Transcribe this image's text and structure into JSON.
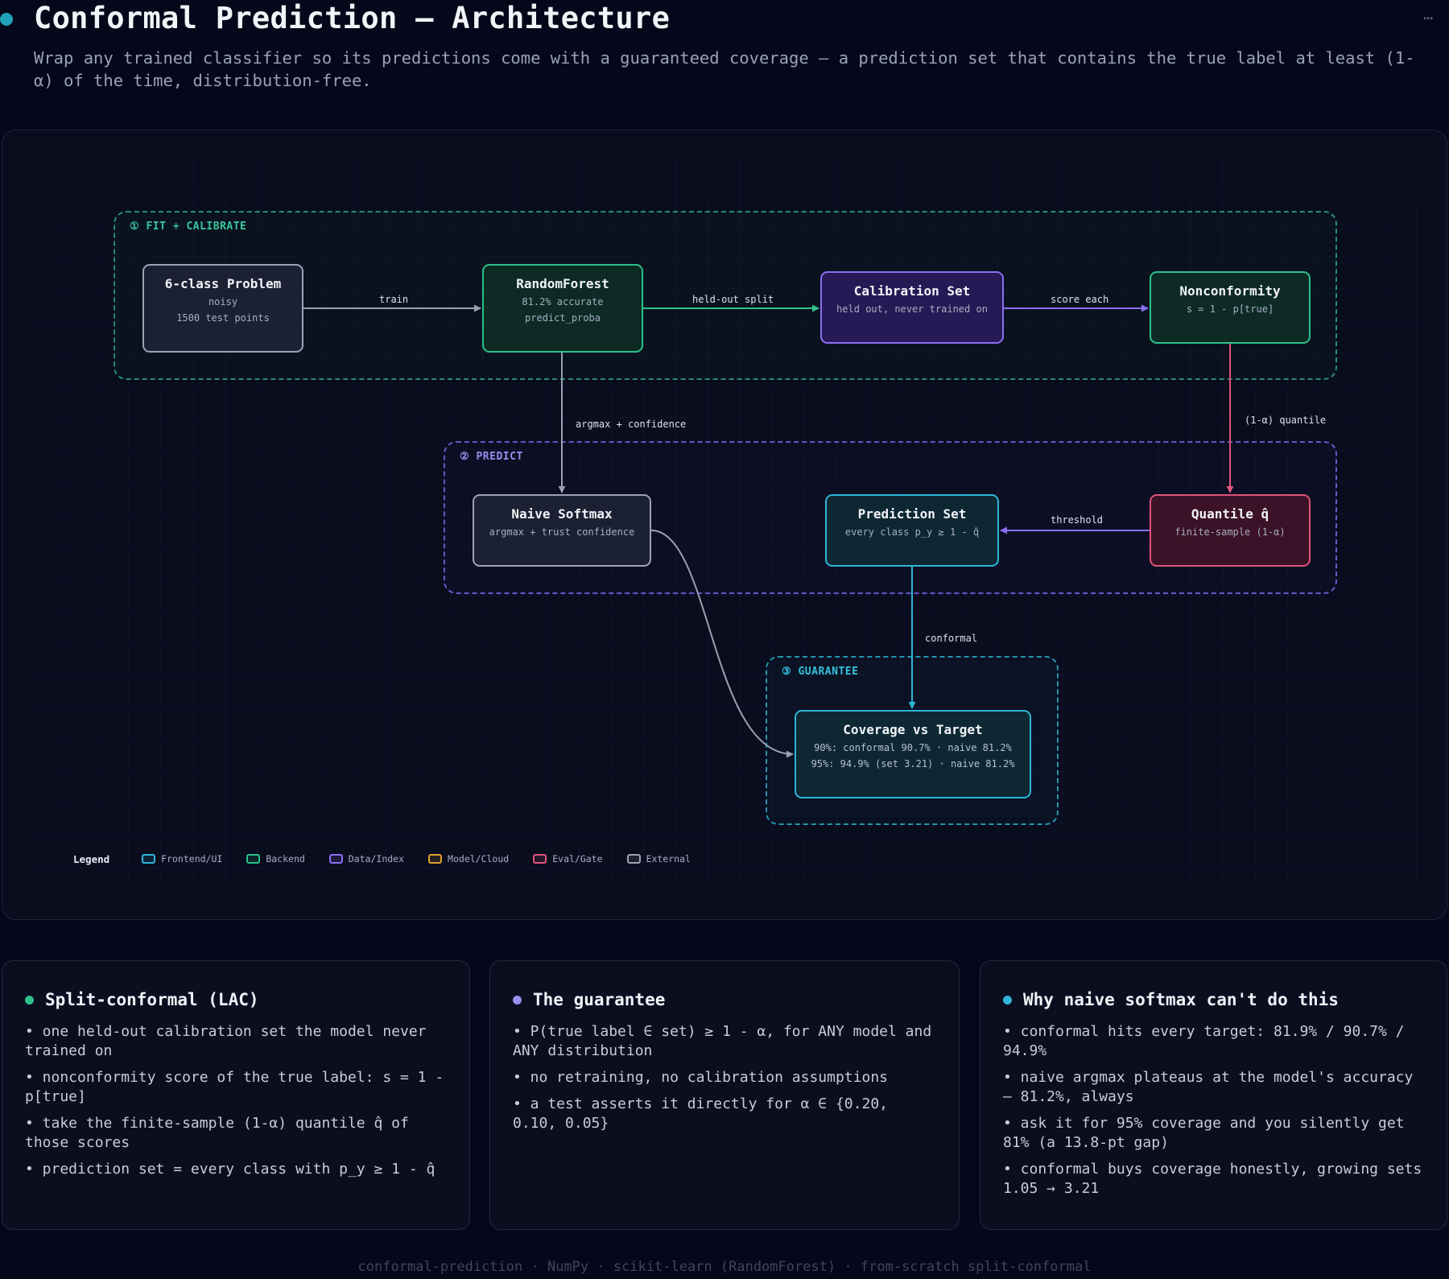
{
  "header": {
    "title": "Conformal Prediction — Architecture",
    "subtitle": "Wrap any trained classifier so its predictions come with a guaranteed coverage — a prediction set that contains the true label at least (1-α) of the time, distribution-free."
  },
  "groups": {
    "fit": "① FIT + CALIBRATE",
    "predict": "② PREDICT",
    "guarantee": "③ GUARANTEE"
  },
  "nodes": {
    "problem": {
      "title": "6-class Problem",
      "sub1": "noisy",
      "sub2": "1500 test points"
    },
    "rf": {
      "title": "RandomForest",
      "sub1": "81.2% accurate",
      "sub2": "predict_proba"
    },
    "calib": {
      "title": "Calibration Set",
      "sub1": "held out, never trained on"
    },
    "nonconf": {
      "title": "Nonconformity",
      "sub1": "s = 1 - p[true]"
    },
    "naive": {
      "title": "Naive Softmax",
      "sub1": "argmax + trust confidence"
    },
    "predset": {
      "title": "Prediction Set",
      "sub1": "every class p_y ≥ 1 - q̂"
    },
    "quantile": {
      "title": "Quantile q̂",
      "sub1": "finite-sample (1-α)"
    },
    "coverage": {
      "title": "Coverage vs Target",
      "sub1": "90%: conformal 90.7% · naive 81.2%",
      "sub2": "95%: 94.9% (set 3.21) · naive 81.2%"
    }
  },
  "edges": {
    "train": "train",
    "heldout": "held-out split",
    "score": "score each",
    "argmax": "argmax + confidence",
    "quantile": "(1-α) quantile",
    "threshold": "threshold",
    "conformal": "conformal"
  },
  "legend": {
    "title": "Legend",
    "items": [
      {
        "label": "Frontend/UI",
        "color": "#2fb6d8"
      },
      {
        "label": "Backend",
        "color": "#2cc28a"
      },
      {
        "label": "Data/Index",
        "color": "#8c6ff0"
      },
      {
        "label": "Model/Cloud",
        "color": "#e0a030"
      },
      {
        "label": "Eval/Gate",
        "color": "#e0547a"
      },
      {
        "label": "External",
        "color": "#9da3b2"
      }
    ]
  },
  "cards": [
    {
      "title": "Split-conformal (LAC)",
      "dot_color": "#2cc28a",
      "bullets": [
        "• one held-out calibration set the model never trained on",
        "• nonconformity score of the true label: s = 1 - p[true]",
        "• take the finite-sample (1-α) quantile q̂ of those scores",
        "• prediction set = every class with p_y ≥ 1 - q̂"
      ]
    },
    {
      "title": "The guarantee",
      "dot_color": "#9a8df0",
      "bullets": [
        "• P(true label ∈ set) ≥ 1 - α, for ANY model and ANY distribution",
        "• no retraining, no calibration assumptions",
        "• a test asserts it directly for α ∈ {0.20, 0.10, 0.05}"
      ]
    },
    {
      "title": "Why naive softmax can't do this",
      "dot_color": "#2fb6d8",
      "bullets": [
        "• conformal hits every target: 81.9% / 90.7% / 94.9%",
        "• naive argmax plateaus at the model's accuracy — 81.2%, always",
        "• ask it for 95% coverage and you silently get 81% (a 13.8-pt gap)",
        "• conformal buys coverage honestly, growing sets 1.05 → 3.21"
      ]
    }
  ],
  "footer": "conformal-prediction · NumPy · scikit-learn (RandomForest) · from-scratch split-conformal"
}
